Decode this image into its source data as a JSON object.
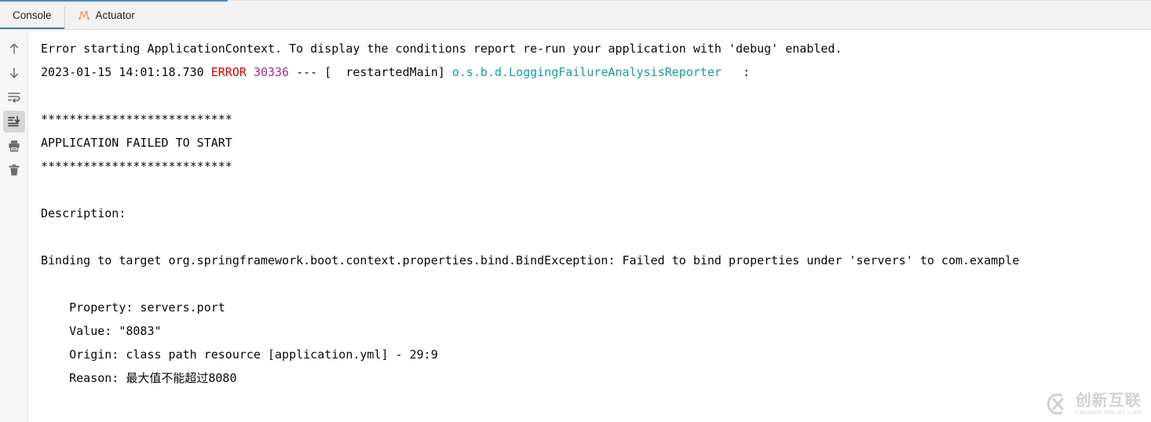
{
  "tabs": [
    {
      "label": "Console",
      "icon": "console-icon",
      "active": true
    },
    {
      "label": "Actuator",
      "icon": "actuator-graph-icon",
      "active": false
    }
  ],
  "toolbar": {
    "buttons": [
      {
        "name": "up-arrow-icon",
        "label": "Up"
      },
      {
        "name": "down-arrow-icon",
        "label": "Down"
      },
      {
        "name": "soft-wrap-icon",
        "label": "Soft-Wrap"
      },
      {
        "name": "scroll-to-end-icon",
        "label": "Scroll to End",
        "selected": true
      },
      {
        "name": "print-icon",
        "label": "Print"
      },
      {
        "name": "trash-icon",
        "label": "Clear All"
      }
    ]
  },
  "console": {
    "lines": [
      {
        "segments": [
          {
            "text": "Error starting ApplicationContext. To display the conditions report re-run your application with 'debug' enabled.",
            "style": "plain"
          }
        ]
      },
      {
        "segments": [
          {
            "text": "2023-01-15 14:01:18.730 ",
            "style": "plain"
          },
          {
            "text": "ERROR",
            "style": "error"
          },
          {
            "text": " ",
            "style": "plain"
          },
          {
            "text": "30336",
            "style": "pid"
          },
          {
            "text": " --- [  restartedMain] ",
            "style": "plain"
          },
          {
            "text": "o.s.b.d.LoggingFailureAnalysisReporter",
            "style": "logger"
          },
          {
            "text": "   :",
            "style": "plain"
          }
        ]
      },
      {
        "segments": [
          {
            "text": "",
            "style": "plain"
          }
        ]
      },
      {
        "segments": [
          {
            "text": "***************************",
            "style": "plain"
          }
        ]
      },
      {
        "segments": [
          {
            "text": "APPLICATION FAILED TO START",
            "style": "plain"
          }
        ]
      },
      {
        "segments": [
          {
            "text": "***************************",
            "style": "plain"
          }
        ]
      },
      {
        "segments": [
          {
            "text": "",
            "style": "plain"
          }
        ]
      },
      {
        "segments": [
          {
            "text": "Description:",
            "style": "plain"
          }
        ]
      },
      {
        "segments": [
          {
            "text": "",
            "style": "plain"
          }
        ]
      },
      {
        "segments": [
          {
            "text": "Binding to target org.springframework.boot.context.properties.bind.BindException: Failed to bind properties under 'servers' to com.example",
            "style": "plain"
          }
        ]
      },
      {
        "segments": [
          {
            "text": "",
            "style": "plain"
          }
        ]
      },
      {
        "segments": [
          {
            "text": "    Property: servers.port",
            "style": "plain"
          }
        ]
      },
      {
        "segments": [
          {
            "text": "    Value: \"8083\"",
            "style": "plain"
          }
        ]
      },
      {
        "segments": [
          {
            "text": "    Origin: class path resource [application.yml] - 29:9",
            "style": "plain"
          }
        ]
      },
      {
        "segments": [
          {
            "text": "    Reason: 最大值不能超过8080",
            "style": "plain"
          }
        ]
      }
    ]
  },
  "watermark": {
    "cn": "创新互联",
    "en": "CHUANG XIN HU LIAN",
    "logo_letters": "CX"
  },
  "colors": {
    "accent": "#3b7cb8",
    "error": "#cc0000",
    "pid": "#a329a3",
    "logger": "#14a098",
    "tabbar_bg": "#f2f2f2",
    "gutter_bg": "#f7f7f7",
    "console_bg": "#ffffff"
  }
}
